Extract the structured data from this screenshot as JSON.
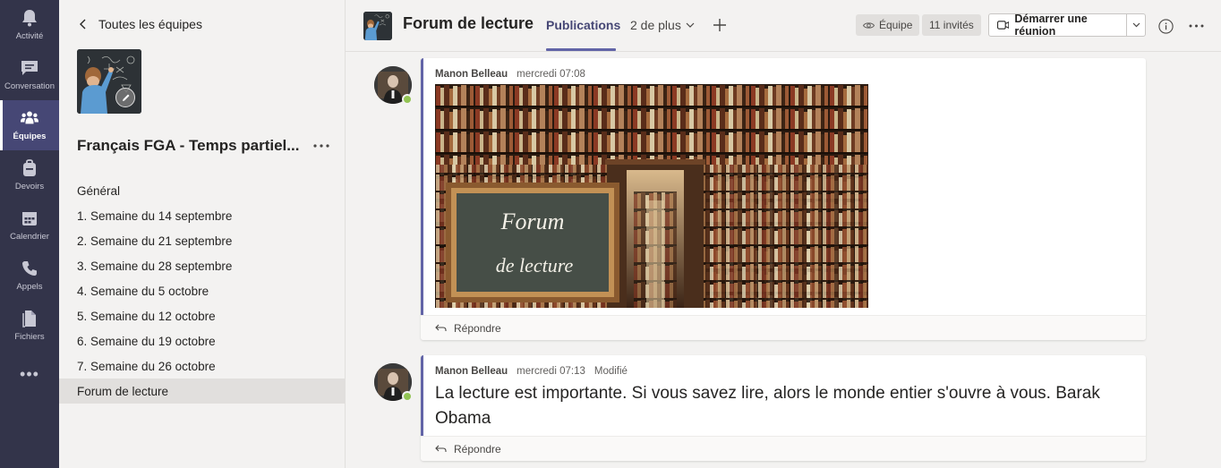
{
  "rail": {
    "items": [
      {
        "label": "Activité"
      },
      {
        "label": "Conversation"
      },
      {
        "label": "Équipes"
      },
      {
        "label": "Devoirs"
      },
      {
        "label": "Calendrier"
      },
      {
        "label": "Appels"
      },
      {
        "label": "Fichiers"
      }
    ],
    "more_label": "•••"
  },
  "team": {
    "back_label": "Toutes les équipes",
    "name": "Français FGA - Temps partiel...",
    "more_label": "•••",
    "channels": [
      {
        "label": "Général"
      },
      {
        "label": "1. Semaine du 14 septembre"
      },
      {
        "label": "2. Semaine du 21 septembre"
      },
      {
        "label": "3. Semaine du 28 septembre"
      },
      {
        "label": "4. Semaine du 5 octobre"
      },
      {
        "label": "5. Semaine du 12 octobre"
      },
      {
        "label": "6. Semaine du 19 octobre"
      },
      {
        "label": "7. Semaine du 26 octobre"
      },
      {
        "label": "Forum de lecture"
      }
    ]
  },
  "header": {
    "channel_title": "Forum de lecture",
    "tab_active": "Publications",
    "tab_more": "2 de plus",
    "team_pill": "Équipe",
    "guests_pill": "11 invités",
    "meet_label": "Démarrer une réunion",
    "more_label": "•••"
  },
  "posts": [
    {
      "author": "Manon Belleau",
      "time": "mercredi 07:08",
      "modified": "",
      "image_text_line1": "Forum",
      "image_text_line2": "de lecture",
      "reply_label": "Répondre"
    },
    {
      "author": "Manon Belleau",
      "time": "mercredi 07:13",
      "modified": "Modifié",
      "text": "La lecture est importante. Si vous savez lire, alors le monde entier s'ouvre à vous. Barak Obama",
      "reply_label": "Répondre"
    }
  ],
  "colors": {
    "rail_bg": "#33344a",
    "accent": "#6264a7",
    "presence_available": "#92c353"
  }
}
